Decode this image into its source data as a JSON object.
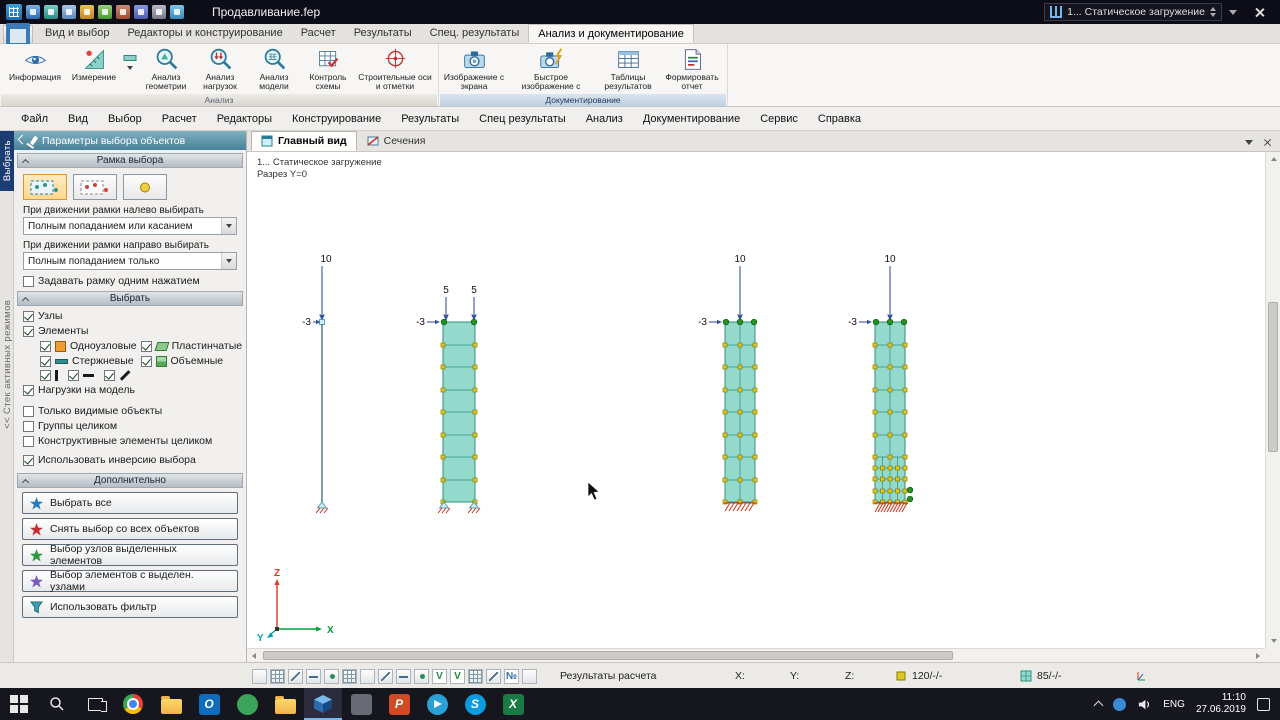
{
  "titlebar": {
    "title": "Продавливание.fep",
    "load_case": "1... Статическое загружение"
  },
  "ribbon_tabs": {
    "items": [
      "Вид и выбор",
      "Редакторы и конструирование",
      "Расчет",
      "Результаты",
      "Спец. результаты",
      "Анализ и документирование"
    ]
  },
  "ribbon": {
    "groups": [
      {
        "label": "Анализ",
        "items": [
          {
            "label": "Информация"
          },
          {
            "label": "Измерение"
          },
          {
            "label": "Анализ геометрии"
          },
          {
            "label": "Анализ нагрузок"
          },
          {
            "label": "Анализ модели"
          },
          {
            "label": "Контроль схемы"
          },
          {
            "label": "Строительные оси и отметки"
          }
        ]
      },
      {
        "label": "Документирование",
        "items": [
          {
            "label": "Изображение с экрана"
          },
          {
            "label": "Быстрое изображение с экрана"
          },
          {
            "label": "Таблицы результатов"
          },
          {
            "label": "Формировать отчет"
          }
        ]
      }
    ]
  },
  "menu": {
    "items": [
      "Файл",
      "Вид",
      "Выбор",
      "Расчет",
      "Редакторы",
      "Конструирование",
      "Результаты",
      "Спец результаты",
      "Анализ",
      "Документирование",
      "Сервис",
      "Справка"
    ]
  },
  "left_strip": {
    "badge": "Выбрать",
    "stack_label": "<< Стек активных режимов"
  },
  "sidebar": {
    "title": "Параметры выбора объектов",
    "frame": {
      "title": "Рамка выбора",
      "left_label": "При движении рамки налево выбирать",
      "left_value": "Полным попаданием или касанием",
      "right_label": "При движении рамки направо выбирать",
      "right_value": "Полным попаданием только",
      "single_click": "Задавать рамку одним нажатием"
    },
    "select": {
      "title": "Выбрать",
      "nodes": "Узлы",
      "elements": "Элементы",
      "single_node": "Одноузловые",
      "plates": "Пластинчатые",
      "bars": "Стержневые",
      "solids": "Объемные",
      "loads": "Нагрузки на модель",
      "visible_only": "Только видимые объекты",
      "groups_whole": "Группы целиком",
      "struct_whole": "Конструктивные элементы целиком",
      "invert": "Использовать инверсию выбора"
    },
    "extra": {
      "title": "Дополнительно",
      "buttons": [
        "Выбрать все",
        "Снять выбор со всех объектов",
        "Выбор узлов выделенных элементов",
        "Выбор элементов с выделен. узлами",
        "Использовать фильтр"
      ]
    }
  },
  "view": {
    "tabs": [
      "Главный вид",
      "Сечения"
    ]
  },
  "canvas": {
    "annotation_1": "1... Статическое загружение",
    "annotation_2": "Разрез Y=0",
    "columns": [
      {
        "top_loads": [
          "10"
        ],
        "side_load": "-3"
      },
      {
        "top_loads": [
          "5",
          "5"
        ],
        "side_load": "-3"
      },
      {
        "top_loads": [
          "10"
        ],
        "side_load": "-3"
      },
      {
        "top_loads": [
          "10"
        ],
        "side_load": "-3"
      }
    ],
    "axes": {
      "x": "X",
      "y": "Y",
      "z": "Z"
    }
  },
  "statusbar": {
    "message": "Результаты расчета",
    "x_label": "X:",
    "y_label": "Y:",
    "z_label": "Z:",
    "nodes_counter": "120/-/-",
    "elements_counter": "85/-/-",
    "glyphs": {
      "num": "№",
      "v1": "V",
      "v2": "V"
    }
  },
  "taskbar": {
    "lang": "ENG",
    "time": "11:10",
    "date": "27.06.2019",
    "app_glyphs": {
      "outlook": "O",
      "powerpoint": "P",
      "skype": "S",
      "excel": "X"
    }
  },
  "colors": {
    "column_fill": "#93dacd",
    "column_edge": "#2f8d7f",
    "node_yellow": "#ddc922",
    "green_node": "#259025",
    "support_red": "#d03018",
    "axis_x": "#00a040",
    "axis_y": "#00a0a8",
    "axis_z": "#e23420",
    "accent_blue": "#2a6aaa"
  }
}
